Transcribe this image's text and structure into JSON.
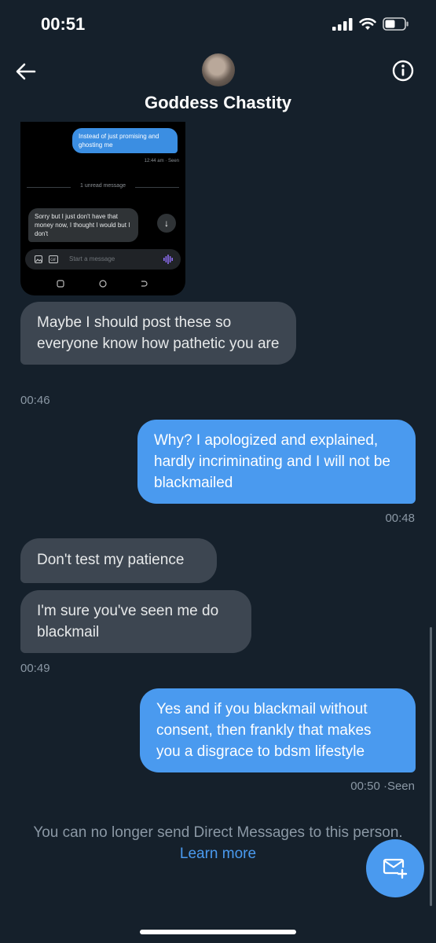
{
  "status_bar": {
    "time": "00:51"
  },
  "header": {
    "contact_name": "Goddess Chastity"
  },
  "embedded_screenshot": {
    "outgoing_message": "Instead of just promising and ghosting me",
    "outgoing_meta": "12:44 am · Seen",
    "unread_divider": "1 unread message",
    "incoming_message": "Sorry but I just don't have that money now, I thought I would but I don't",
    "composer_placeholder": "Start a message"
  },
  "messages": [
    {
      "direction": "in",
      "text": "Maybe I should post these so everyone know how pathetic you are",
      "time": "00:46"
    },
    {
      "direction": "out",
      "text": "Why? I apologized and explained, hardly incriminating and I will not be blackmailed",
      "time": "00:48"
    },
    {
      "direction": "in",
      "text": "Don't test my patience"
    },
    {
      "direction": "in",
      "text": "I'm sure you've seen me do blackmail",
      "time": "00:49"
    },
    {
      "direction": "out",
      "text": "Yes and if you blackmail without consent, then frankly that makes you a disgrace to bdsm lifestyle",
      "time": "00:50",
      "status": "·Seen"
    }
  ],
  "footer": {
    "notice": "You can no longer send Direct Messages to this person.",
    "learn_more": "Learn more"
  },
  "colors": {
    "background": "#15202b",
    "incoming_bubble": "#3d4651",
    "outgoing_bubble": "#4a9aef",
    "accent": "#4a9aef"
  }
}
